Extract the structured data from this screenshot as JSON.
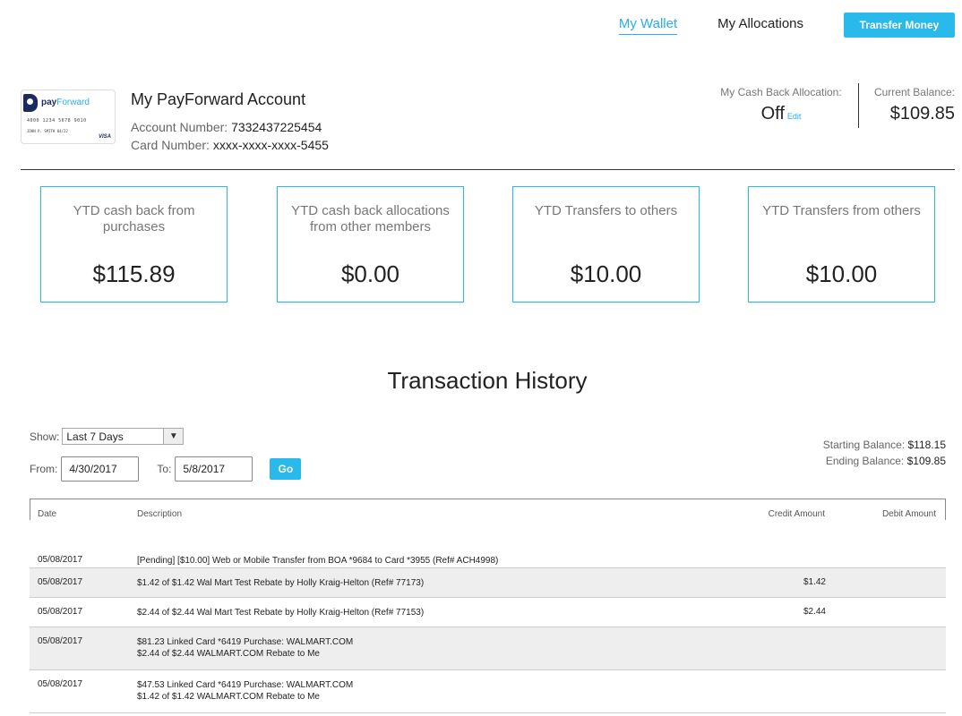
{
  "nav": {
    "wallet": "My Wallet",
    "allocations": "My Allocations",
    "transfer": "Transfer Money"
  },
  "card": {
    "brand_pay": "pay",
    "brand_forward": "Forward",
    "number": "4000 1234 5678 9010",
    "name": "JOHN P. SMITH",
    "exp": "04/22",
    "network": "VISA"
  },
  "account": {
    "title": "My PayForward Account",
    "account_label": "Account Number:",
    "account_number": "7332437225454",
    "card_label": "Card Number:",
    "card_number": "xxxx-xxxx-xxxx-5455",
    "cashback_label": "My Cash Back Allocation:",
    "cashback_value": "Off",
    "cashback_edit": "Edit",
    "balance_label": "Current Balance:",
    "balance_value": "$109.85"
  },
  "stats": [
    {
      "label": "YTD cash back from purchases",
      "amount": "$115.89"
    },
    {
      "label": "YTD cash back allocations from other members",
      "amount": "$0.00"
    },
    {
      "label": "YTD Transfers to others",
      "amount": "$10.00"
    },
    {
      "label": "YTD Transfers from others",
      "amount": "$10.00"
    }
  ],
  "history": {
    "title": "Transaction History",
    "show_label": "Show:",
    "show_value": "Last 7 Days",
    "from_label": "From:",
    "from_value": "4/30/2017",
    "to_label": "To:",
    "to_value": "5/8/2017",
    "go": "Go",
    "starting_label": "Starting Balance:",
    "starting_value": "$118.15",
    "ending_label": "Ending Balance:",
    "ending_value": "$109.85"
  },
  "table": {
    "headers": {
      "date": "Date",
      "description": "Description",
      "credit": "Credit Amount",
      "debit": "Debit Amount"
    },
    "rows": [
      {
        "date": "05/08/2017",
        "line1": "[Pending] [$10.00] Web or Mobile Transfer from BOA *9684 to Card *3955 (Ref# ACH4998)",
        "line2": "",
        "credit": "",
        "debit": ""
      },
      {
        "date": "05/08/2017",
        "line1": "$1.42 of $1.42 Wal Mart Test Rebate by Holly Kraig-Helton (Ref# 77173)",
        "line2": "",
        "credit": "$1.42",
        "debit": ""
      },
      {
        "date": "05/08/2017",
        "line1": "$2.44 of $2.44 Wal Mart Test Rebate by Holly Kraig-Helton (Ref# 77153)",
        "line2": "",
        "credit": "$2.44",
        "debit": ""
      },
      {
        "date": "05/08/2017",
        "line1": "$81.23 Linked Card *6419 Purchase: WALMART.COM",
        "line2": "$2.44 of $2.44 WALMART.COM Rebate to Me",
        "credit": "",
        "debit": ""
      },
      {
        "date": "05/08/2017",
        "line1": "$47.53 Linked Card *6419 Purchase: WALMART.COM",
        "line2": "$1.42 of $1.42 WALMART.COM Rebate to Me",
        "credit": "",
        "debit": ""
      }
    ]
  }
}
